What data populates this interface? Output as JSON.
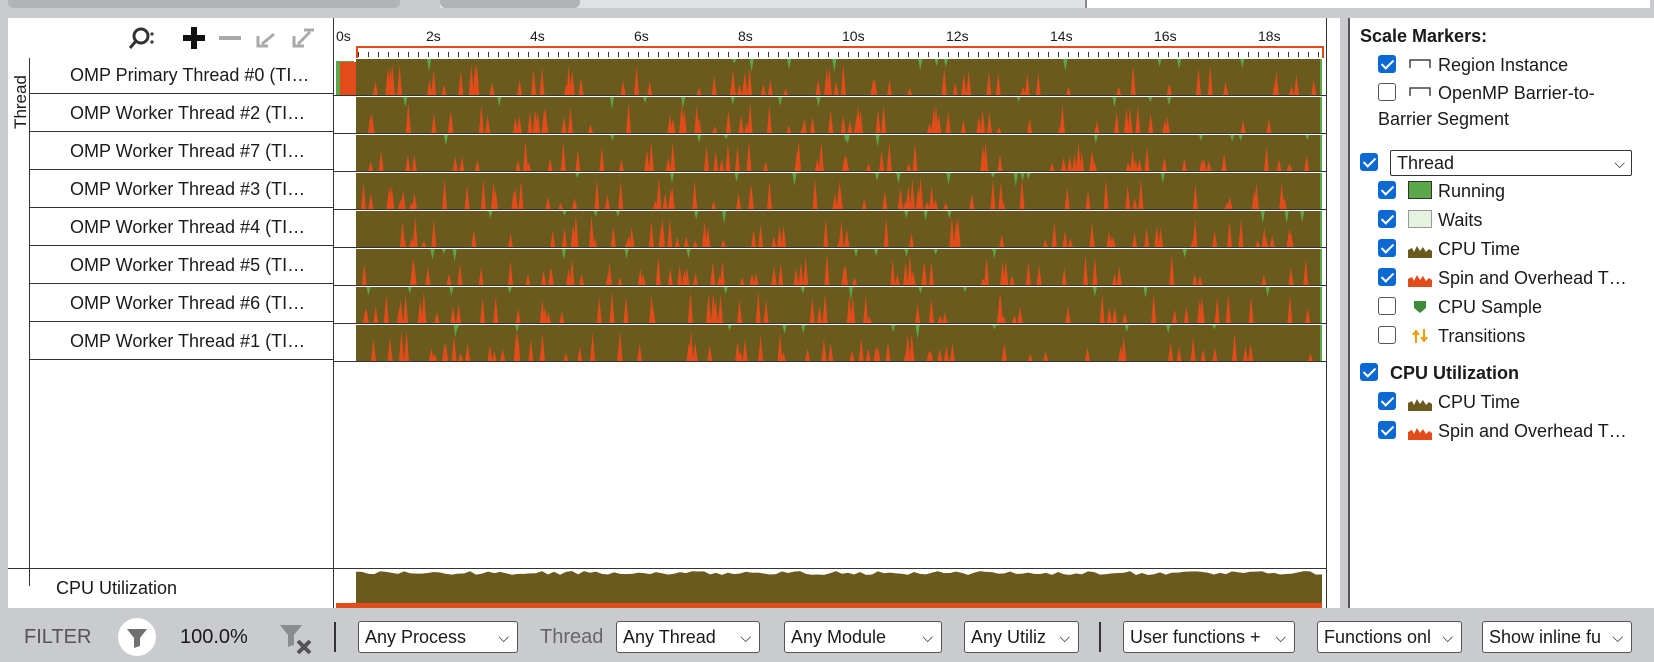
{
  "timeline": {
    "thread_group_label": "Thread",
    "time_ticks": [
      "0s",
      "2s",
      "4s",
      "6s",
      "8s",
      "10s",
      "12s",
      "14s",
      "16s",
      "18s"
    ],
    "threads": [
      {
        "label": "OMP Primary Thread #0 (TID: ...)",
        "visible": "OMP Primary Thread #0 (TI…"
      },
      {
        "label": "OMP Worker Thread #2",
        "visible": "OMP Worker Thread #2 (TI…"
      },
      {
        "label": "OMP Worker Thread #7",
        "visible": "OMP Worker Thread #7 (TI…"
      },
      {
        "label": "OMP Worker Thread #3",
        "visible": "OMP Worker Thread #3 (TI…"
      },
      {
        "label": "OMP Worker Thread #4",
        "visible": "OMP Worker Thread #4 (TI…"
      },
      {
        "label": "OMP Worker Thread #5",
        "visible": "OMP Worker Thread #5 (TI…"
      },
      {
        "label": "OMP Worker Thread #6",
        "visible": "OMP Worker Thread #6 (TI…"
      },
      {
        "label": "OMP Worker Thread #1",
        "visible": "OMP Worker Thread #1 (TI…"
      }
    ],
    "cpu_utilization_label": "CPU Utilization",
    "colors": {
      "cpu_time": "#6b5a1e",
      "spin": "#e24c1a",
      "running": "#5aa84a",
      "waits": "#e3f3dd",
      "accent": "#e24c1a"
    }
  },
  "legend": {
    "scale_markers_title": "Scale Markers:",
    "region_instance": "Region Instance",
    "barrier_line1": "OpenMP Barrier-to-",
    "barrier_line2": "Barrier Segment",
    "thread_select": "Thread",
    "running": "Running",
    "waits": "Waits",
    "cpu_time": "CPU Time",
    "spin_overhead": "Spin and Overhead T…",
    "cpu_sample": "CPU Sample",
    "transitions": "Transitions",
    "cpu_util_title": "CPU Utilization",
    "cpu_time_2": "CPU Time",
    "spin_overhead_2": "Spin and Overhead T…"
  },
  "filter": {
    "label": "FILTER",
    "percent": "100.0%",
    "thread_label": "Thread",
    "process": "Any Process",
    "thread": "Any Thread",
    "module": "Any Module",
    "utilization": "Any Utiliz",
    "user_functions": "User functions +",
    "functions_only": "Functions onl",
    "inline": "Show inline fu"
  }
}
